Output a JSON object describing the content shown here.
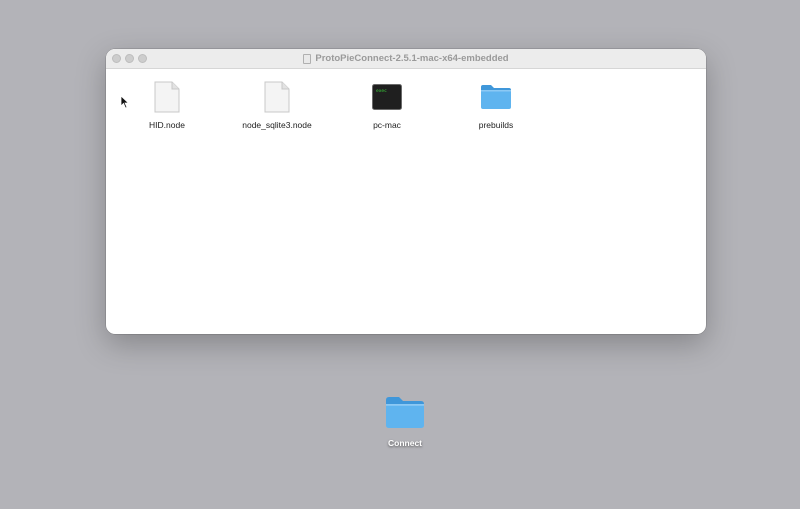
{
  "window": {
    "title": "ProtoPieConnect-2.5.1-mac-x64-embedded",
    "files": [
      {
        "name": "HID.node",
        "icon": "document-icon"
      },
      {
        "name": "node_sqlite3.node",
        "icon": "document-icon"
      },
      {
        "name": "pc-mac",
        "icon": "terminal-exec-icon",
        "icon_text": "exec"
      },
      {
        "name": "prebuilds",
        "icon": "folder-icon"
      }
    ]
  },
  "desktop": {
    "folder_name": "Connect",
    "folder_icon": "folder-icon"
  },
  "colors": {
    "desktop_bg": "#b3b3b8",
    "folder_blue": "#5fb4ef",
    "folder_tab": "#3f97da",
    "terminal_bg": "#1f1f1f",
    "terminal_text": "#3ad13a"
  }
}
